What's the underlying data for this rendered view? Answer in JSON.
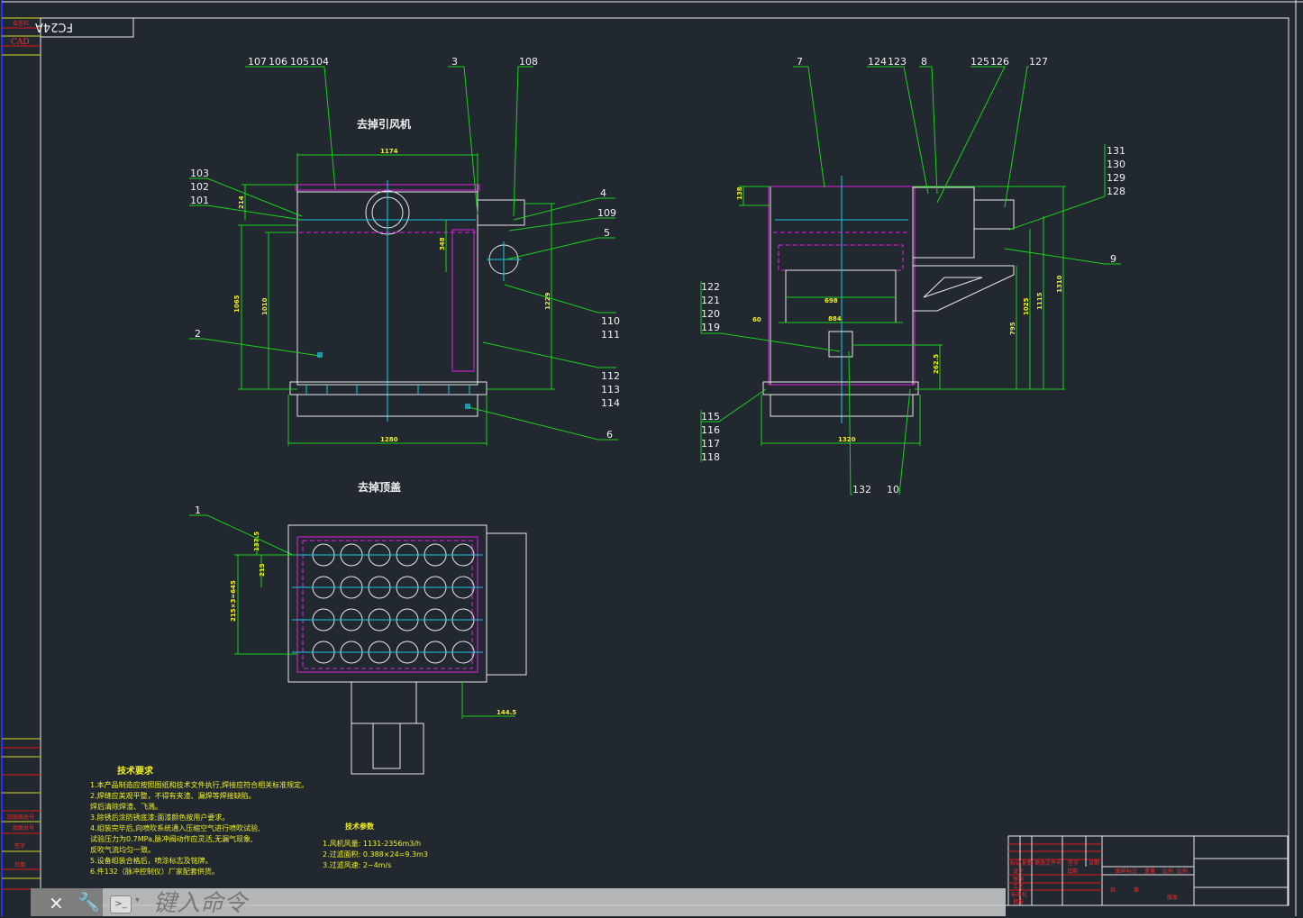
{
  "drawing_id": "FC24A",
  "left_strip": {
    "top_label": "会签栏",
    "cad_label": "CAD",
    "bottom_labels": [
      "旧底图总号",
      "底图总号",
      "签字",
      "日期"
    ]
  },
  "views": {
    "front_title": "去掉引风机",
    "top_title": "去掉顶盖"
  },
  "callouts": [
    "107",
    "106",
    "105",
    "104",
    "3",
    "108",
    "103",
    "102",
    "101",
    "4",
    "109",
    "5",
    "110",
    "111",
    "112",
    "113",
    "114",
    "2",
    "6",
    "1",
    "7",
    "124",
    "123",
    "8",
    "125",
    "126",
    "127",
    "131",
    "130",
    "129",
    "128",
    "9",
    "122",
    "121",
    "120",
    "119",
    "115",
    "116",
    "117",
    "118",
    "132",
    "10"
  ],
  "dimensions": [
    "1174",
    "214",
    "1065",
    "1010",
    "348",
    "1229",
    "1280",
    "138",
    "698",
    "884",
    "60",
    "1320",
    "262.5",
    "795",
    "1025",
    "1115",
    "1310",
    "137.5",
    "215",
    "215×3=645",
    "144.5"
  ],
  "tech_requirements": {
    "title": "技术要求",
    "lines": [
      "1.本产品制造应按照图纸和技术文件执行,焊接应符合相关标准规定。",
      "2.焊缝应美观平整，不得有夹渣、漏焊等焊接缺陷。",
      "  焊后清除焊渣、飞溅。",
      "3.除锈后涂防锈底漆;面漆颜色按用户要求。",
      "4.组装完毕后,向喷吹系统通入压缩空气进行喷吹试验,",
      "  试验压力为0.7MPa,脉冲阀动作应灵活,无漏气现象,",
      "  反吹气流均匀一致。",
      "5.设备组装合格后，喷涂标志及铭牌。",
      "6.件132（脉冲控制仪）厂家配套供货。"
    ]
  },
  "tech_params": {
    "title": "技术参数",
    "lines": [
      "1.风机风量: 1131-2356m3/h",
      "2.过滤面积: 0.388×24=9.3m3",
      "3.过滤风速: 2~4m/s"
    ]
  },
  "title_block": {
    "header": [
      "标记",
      "处数",
      "更改文件号",
      "签字",
      "日期"
    ],
    "rows": [
      "设计",
      "审核",
      "工艺",
      "标准化",
      "批准"
    ],
    "date_label": "日期",
    "stage": [
      "图样标记",
      "重量",
      "比例"
    ],
    "sheet": "共",
    "page": "第",
    "version": "版本"
  },
  "command_line": {
    "placeholder": "键入命令",
    "close": "×",
    "customize": "🔧",
    "prompt_icon": ">_"
  },
  "colors": {
    "background": "#212830",
    "leader": "#19d119",
    "centerline": "#19c8e0",
    "hidden": "#e020e0",
    "dimension_text": "#f0f020"
  }
}
